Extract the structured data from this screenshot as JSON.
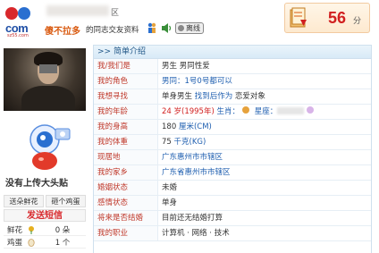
{
  "header": {
    "logo_text": "com",
    "logo_url": "sz55.com",
    "district": "区",
    "username": "傻不拉多",
    "user_tagline": "的同志交友资料",
    "status_label": "离线",
    "score_value": "56",
    "score_unit": "分"
  },
  "left": {
    "upload_prompt": "没有上传大头贴",
    "buttons": [
      "送朵鲜花",
      "砸个鸡蛋"
    ],
    "sms_label": "发送短信",
    "stats": [
      {
        "label": "鲜花",
        "icon": "flower-icon",
        "value": "0 朵"
      },
      {
        "label": "鸡蛋",
        "icon": "egg-icon",
        "value": "1 个"
      }
    ]
  },
  "panel": {
    "title": ">> 简单介绍",
    "rows": [
      {
        "key": "我/我们是",
        "parts": [
          {
            "t": "男生 男同性爱",
            "c": ""
          }
        ]
      },
      {
        "key": "我的角色",
        "parts": [
          {
            "t": "男同：1号0号都可以",
            "c": "blue"
          }
        ]
      },
      {
        "key": "我想寻找",
        "parts": [
          {
            "t": "单身男生",
            "c": ""
          },
          {
            "t": " 找到后作为 ",
            "c": "blue"
          },
          {
            "t": "恋爱对象",
            "c": ""
          }
        ]
      },
      {
        "key": "我的年龄",
        "parts": [
          {
            "t": "24 岁(1995年)",
            "c": "red"
          },
          {
            "t": " 生肖：",
            "c": "blue"
          },
          {
            "t": "ICON",
            "c": "pig-icon"
          },
          {
            "t": " 星座：",
            "c": "blue"
          },
          {
            "t": "BLUR",
            "c": ""
          },
          {
            "t": "ICON",
            "c": "star-sign-icon"
          }
        ]
      },
      {
        "key": "我的身高",
        "parts": [
          {
            "t": "180 ",
            "c": ""
          },
          {
            "t": "厘米(CM)",
            "c": "blue"
          }
        ]
      },
      {
        "key": "我的体重",
        "parts": [
          {
            "t": "75 ",
            "c": ""
          },
          {
            "t": "千克(KG)",
            "c": "blue"
          }
        ]
      },
      {
        "key": "现居地",
        "parts": [
          {
            "t": "广东惠州市市辖区",
            "c": "blue"
          }
        ]
      },
      {
        "key": "我的家乡",
        "parts": [
          {
            "t": "广东省惠州市市辖区",
            "c": "blue"
          }
        ]
      },
      {
        "key": "婚姻状态",
        "parts": [
          {
            "t": "未婚",
            "c": ""
          }
        ]
      },
      {
        "key": "感情状态",
        "parts": [
          {
            "t": "单身",
            "c": ""
          }
        ]
      },
      {
        "key": "将来是否结婚",
        "parts": [
          {
            "t": "目前还无结婚打算",
            "c": ""
          }
        ]
      },
      {
        "key": "我的职业",
        "parts": [
          {
            "t": "计算机 · 网络 · 技术",
            "c": ""
          }
        ]
      }
    ]
  },
  "colors": {
    "accent_red": "#d12020",
    "link_blue": "#1f5fb0",
    "panel_border": "#cfe0ee",
    "username_orange": "#d95a10"
  }
}
